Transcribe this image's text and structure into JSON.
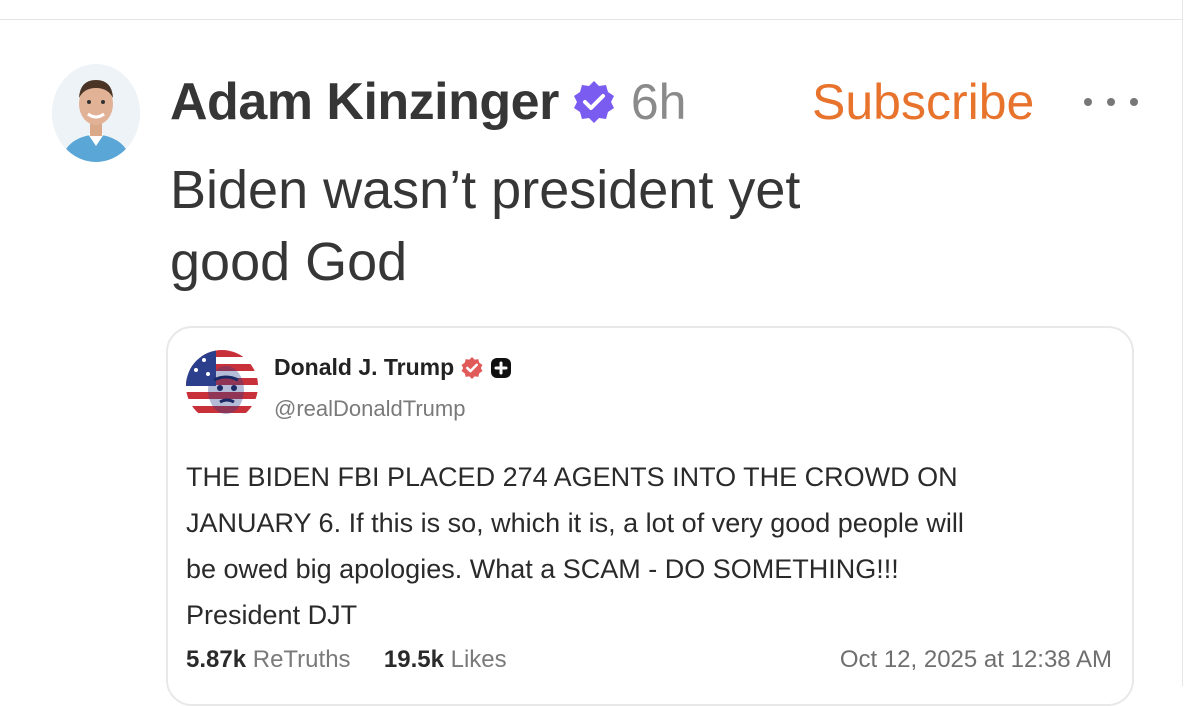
{
  "post": {
    "author": "Adam Kinzinger",
    "time": "6h",
    "subscribe_label": "Subscribe",
    "text_lines": [
      "Biden wasn’t president yet",
      "good God"
    ]
  },
  "quoted": {
    "name": "Donald J. Trump",
    "handle": "@realDonaldTrump",
    "body_lines": [
      "THE BIDEN FBI PLACED 274 AGENTS INTO THE CROWD ON",
      "JANUARY 6. If this is so, which it is, a lot of very good people will",
      "be owed big apologies. What a SCAM - DO SOMETHING!!!",
      "President DJT"
    ],
    "retruths_count": "5.87k",
    "retruths_label": "ReTruths",
    "likes_count": "19.5k",
    "likes_label": "Likes",
    "date": "Oct 12, 2025 at 12:38 AM"
  },
  "icons": {
    "verified": "verified-badge-icon",
    "more": "more-options-icon",
    "plus": "plus-badge-icon"
  },
  "colors": {
    "accent_subscribe": "#e8732c",
    "verified_badge": "#7b5cf0",
    "quoted_verified_badge": "#e05a5a"
  }
}
